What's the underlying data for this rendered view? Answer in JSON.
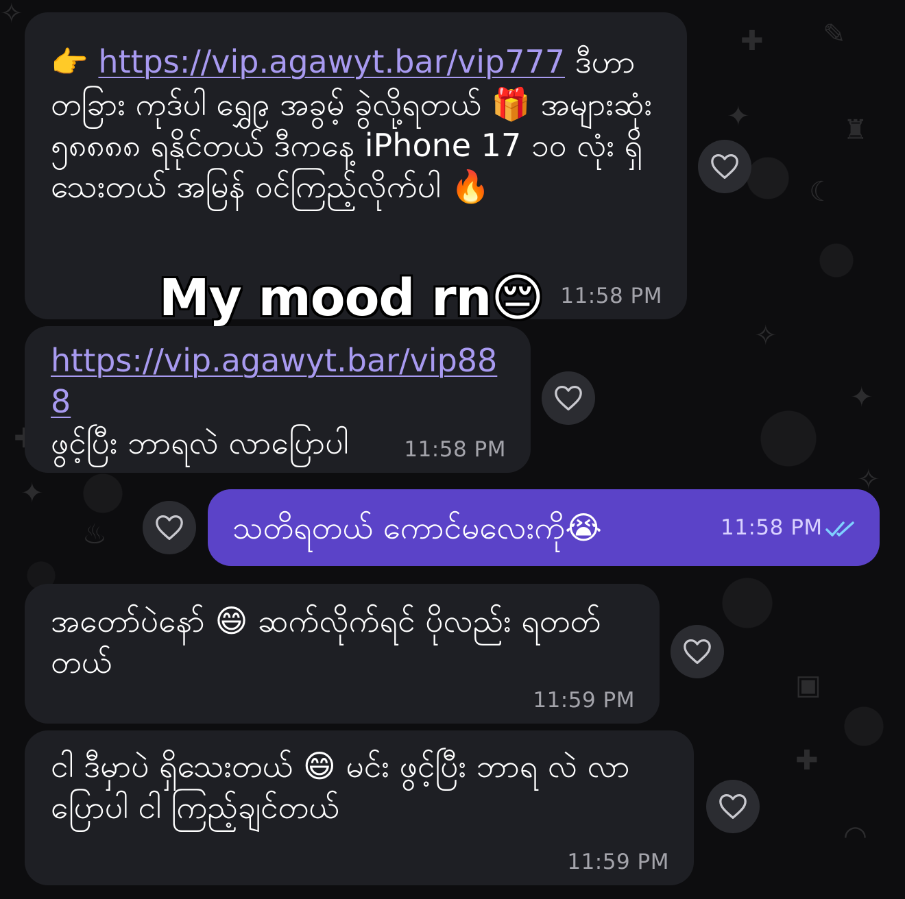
{
  "messages": [
    {
      "direction": "in",
      "pointer_emoji": "👉",
      "link": "https://vip.agawyt.bar/vip777",
      "text_after_link": " ဒီဟာ တခြား ကုဒ်ပါ ရွှေ၉ အခွမ့် ခွဲလို့ရတယ် 🎁 အများဆုံး ၅၈၈၈၈ ရနိုင်တယ် ဒီကနေ့ iPhone 17 ၁၀ လုံး ရှိသေးတယ် အမြန် ဝင်ကြည့်လိုက်ပါ 🔥",
      "sticker_text": "My mood rn😔",
      "time": "11:58 PM"
    },
    {
      "direction": "in",
      "link": "https://vip.agawyt.bar/vip888",
      "text_after_link": "ဖွင့်ပြီး ဘာရလဲ လာပြောပါ",
      "time": "11:58 PM"
    },
    {
      "direction": "out",
      "text": "သတိရတယ် ကောင်မလေးကို😭",
      "time": "11:58 PM"
    },
    {
      "direction": "in",
      "text": "အတော်ပဲနော် 😄 ဆက်လိုက်ရင် ပိုလည်း ရတတ်တယ်",
      "time": "11:59 PM"
    },
    {
      "direction": "in",
      "text": "ငါ ဒီမှာပဲ ရှိသေးတယ် 😄 မင်း ဖွင့်ပြီး ဘာရ လဲ လာပြောပါ ငါ ကြည့်ချင်တယ်",
      "time": "11:59 PM"
    }
  ],
  "icons": {
    "reaction": "heart-outline-icon",
    "read_status": "double-check-icon"
  },
  "colors": {
    "background": "#0d0d0f",
    "incoming_bubble": "#1e1f24",
    "outgoing_bubble": "#5b43c8",
    "link": "#a89af0",
    "read_check": "#7fd0ff"
  }
}
